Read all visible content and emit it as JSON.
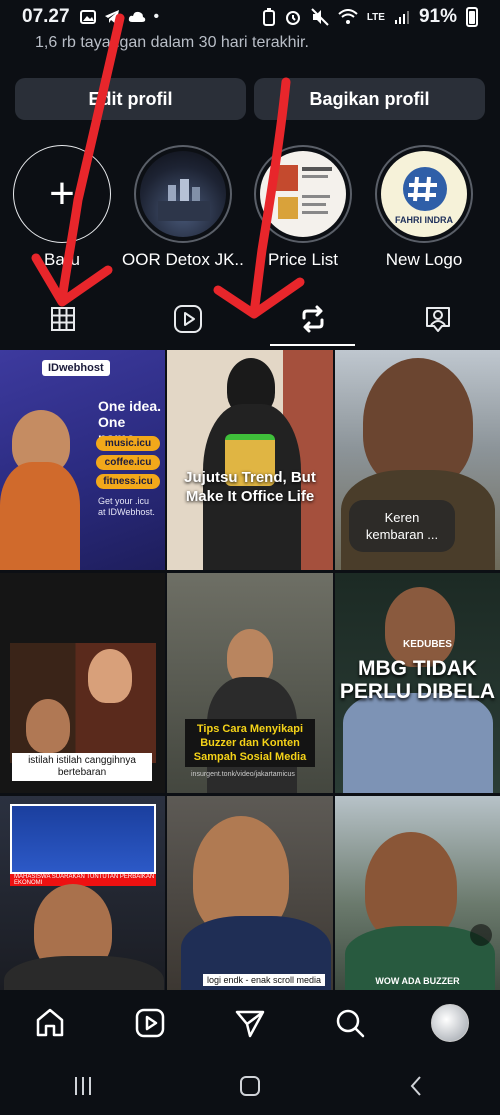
{
  "status_bar": {
    "time": "07.27",
    "battery": "91%",
    "network": "LTE"
  },
  "profile": {
    "views_text": "1,6 rb tayangan dalam 30 hari terakhir.",
    "edit_button": "Edit profil",
    "share_button": "Bagikan profil"
  },
  "highlights": [
    {
      "label": "Baru",
      "kind": "new"
    },
    {
      "label": "OOR Detox JK...",
      "kind": "story"
    },
    {
      "label": "Price List",
      "kind": "story"
    },
    {
      "label": "New Logo",
      "kind": "story",
      "logo_text": "FAHRI INDRA"
    }
  ],
  "tabs": [
    {
      "name": "grid",
      "icon": "grid-icon",
      "active": false
    },
    {
      "name": "reels",
      "icon": "reels-icon",
      "active": false
    },
    {
      "name": "reposts",
      "icon": "repost-icon",
      "active": true
    },
    {
      "name": "tagged",
      "icon": "tagged-icon",
      "active": false
    }
  ],
  "posts": [
    {
      "brand": "IDwebhost",
      "headline_1": "One idea.",
      "headline_2": "One name.",
      "pills": [
        "music.icu",
        "coffee.icu",
        "fitness.icu"
      ],
      "footer_1": "Get your .icu",
      "footer_2": "at IDWebhost."
    },
    {
      "title_1": "Jujutsu Trend, But",
      "title_2": "Make It Office Life"
    },
    {
      "bubble_1": "Keren",
      "bubble_2": "kembaran ..."
    },
    {
      "caption_1": "istilah istilah canggihnya",
      "caption_2": "bertebaran"
    },
    {
      "title_1": "Tips Cara Menyikapi",
      "title_2": "Buzzer dan Konten",
      "title_3": "Sampah Sosial Media",
      "url": "insurgent.tonk/video/jakartamicus"
    },
    {
      "tag": "KEDUBES",
      "title_1": "MBG TIDAK",
      "title_2": "PERLU DIBELA"
    },
    {
      "ticker": "MAHASISWA SUARAKAN TUNTUTAN PERBAIKAN EKONOMI"
    },
    {
      "caption": "logi endk - enak scroll media"
    },
    {
      "caption": "WOW ADA BUZZER"
    }
  ],
  "bottom_nav": [
    "home-icon",
    "reels-icon",
    "send-icon",
    "search-icon",
    "profile-avatar"
  ],
  "colors": {
    "background": "#0c0f14",
    "button": "#2a2f38",
    "annotation": "#e8262b"
  }
}
